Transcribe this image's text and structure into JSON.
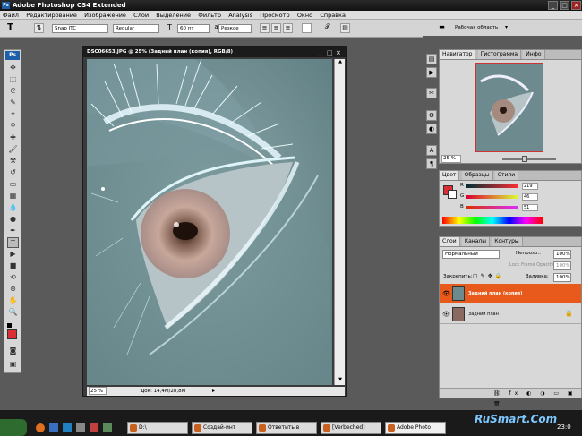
{
  "window": {
    "title": "Adobe Photoshop CS4 Extended"
  },
  "menu": [
    "Файл",
    "Редактирование",
    "Изображение",
    "Слой",
    "Выделение",
    "Фильтр",
    "Analysis",
    "Просмотр",
    "Окно",
    "Справка"
  ],
  "options": {
    "font_family": "Snap ITC",
    "font_style": "Regular",
    "font_size": "60 пт",
    "antialias": "Резкое",
    "workspace": "Рабочая область"
  },
  "document": {
    "title": "DSC06653.JPG @ 25% (Задний план (копия), RGB/8)",
    "zoom": "25 %",
    "doc_size": "Док: 14,4M/28,8M"
  },
  "navigator": {
    "tabs": [
      "Навигатор",
      "Гистограмма",
      "Инфо"
    ],
    "zoom": "25 %"
  },
  "color_panel": {
    "tabs": [
      "Цвет",
      "Образцы",
      "Стили"
    ],
    "channels": [
      {
        "label": "R",
        "value": "219"
      },
      {
        "label": "G",
        "value": "46"
      },
      {
        "label": "B",
        "value": "51"
      }
    ],
    "fg_color": "#db2e33"
  },
  "layers_panel": {
    "tabs": [
      "Слои",
      "Каналы",
      "Контуры"
    ],
    "blend_mode": "Нормальный",
    "opacity_label": "Непрозр.:",
    "opacity": "100%",
    "unify_label": "Lock Frame Opacity",
    "fill_label": "Заливка:",
    "fill": "100%",
    "lock_label": "Закрепить:",
    "lock_opacity": "100%",
    "layers": [
      {
        "name": "Задний план (копия)",
        "selected": true
      },
      {
        "name": "Задний план",
        "selected": false
      }
    ]
  },
  "taskbar": {
    "items": [
      "D:\\",
      "Создай-инт",
      "Ответить в",
      "[Verbeched]",
      "Adobe Photo"
    ],
    "time": "23:0"
  },
  "watermark": "RuSmart.Com",
  "colors": {
    "accent_orange": "#e85a1c",
    "title_bg": "#1b1b1b"
  }
}
